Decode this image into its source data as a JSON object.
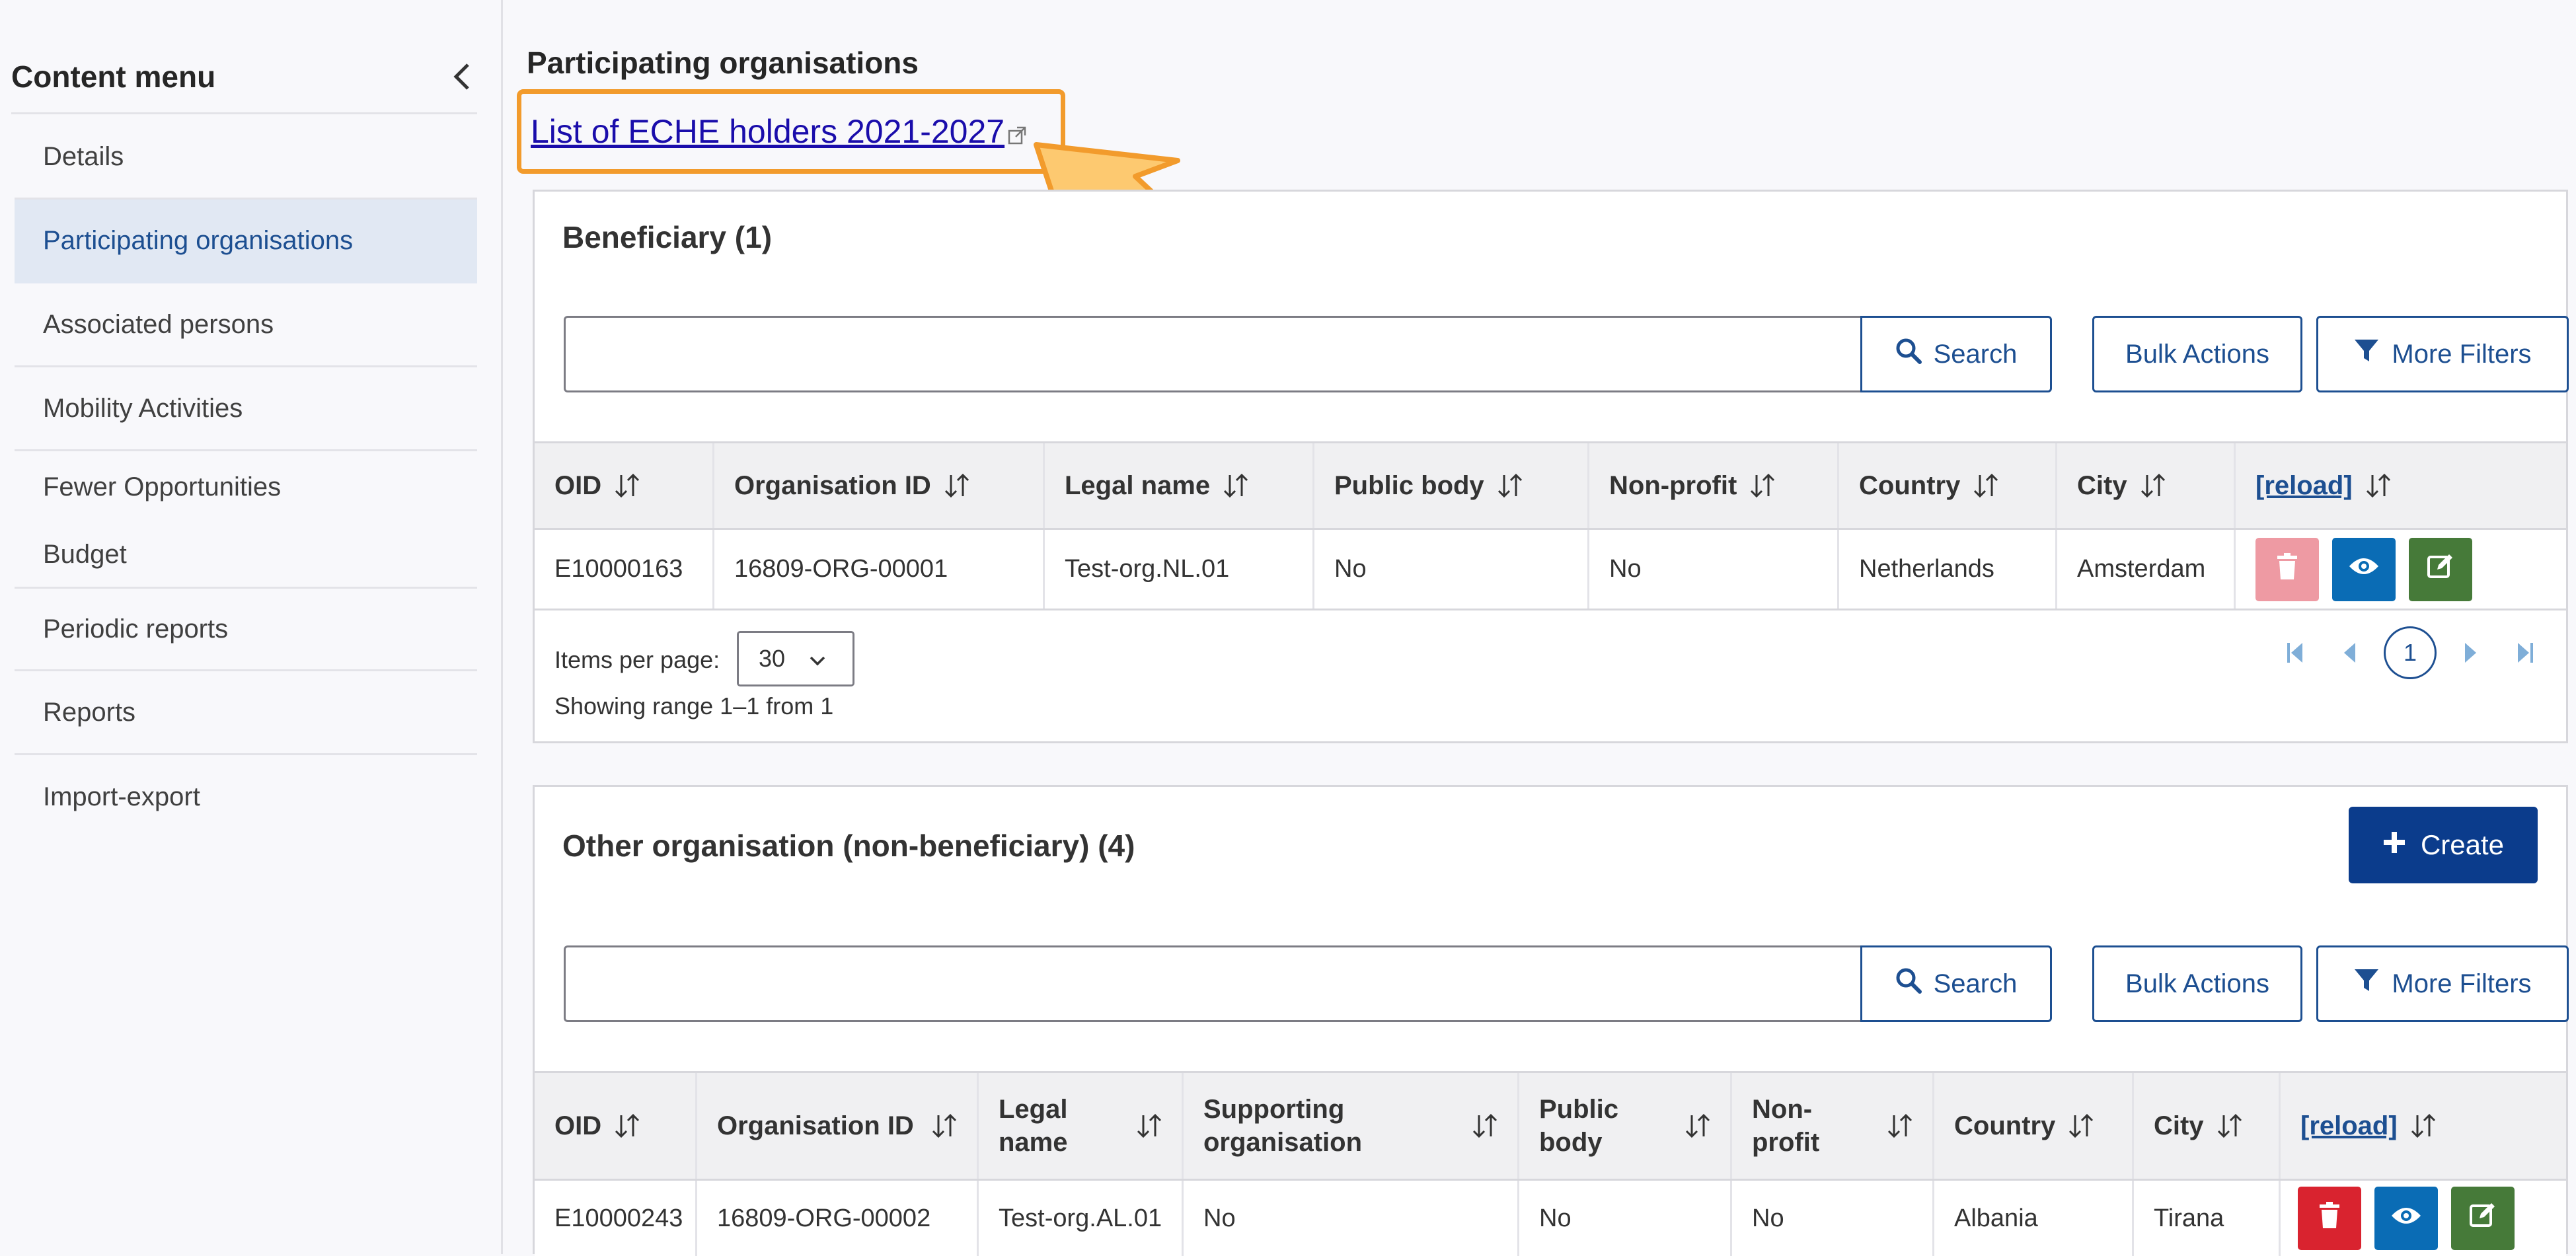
{
  "sidebar": {
    "title": "Content menu",
    "items": [
      {
        "label": "Details"
      },
      {
        "label": "Participating organisations"
      },
      {
        "label": "Associated persons"
      },
      {
        "label": "Mobility Activities"
      },
      {
        "label": "Fewer Opportunities"
      },
      {
        "label": "Budget"
      },
      {
        "label": "Periodic reports"
      },
      {
        "label": "Reports"
      },
      {
        "label": "Import-export"
      }
    ]
  },
  "main": {
    "title": "Participating organisations",
    "eche_link": "List of ECHE holders 2021-2027"
  },
  "toolbar": {
    "search_label": "Search",
    "bulk_label": "Bulk Actions",
    "filters_label": "More Filters",
    "create_label": "Create"
  },
  "beneficiary": {
    "title": "Beneficiary (1)",
    "columns": [
      "OID",
      "Organisation ID",
      "Legal name",
      "Public body",
      "Non-profit",
      "Country",
      "City",
      "[reload]"
    ],
    "rows": [
      {
        "oid": "E10000163",
        "org_id": "16809-ORG-00001",
        "legal_name": "Test-org.NL.01",
        "public_body": "No",
        "non_profit": "No",
        "country": "Netherlands",
        "city": "Amsterdam"
      }
    ],
    "pagination": {
      "items_per_page_label": "Items per page:",
      "items_per_page": "30",
      "range": "Showing range 1–1 from 1",
      "current_page": "1"
    }
  },
  "other": {
    "title": "Other organisation (non-beneficiary) (4)",
    "columns": [
      "OID",
      "Organisation ID",
      "Legal name",
      "Supporting organisation",
      "Public body",
      "Non-profit",
      "Country",
      "City",
      "[reload]"
    ],
    "rows": [
      {
        "oid": "E10000243",
        "org_id": "16809-ORG-00002",
        "legal_name": "Test-org.AL.01",
        "supporting": "No",
        "public_body": "No",
        "non_profit": "No",
        "country": "Albania",
        "city": "Tirana"
      }
    ]
  },
  "colors": {
    "primary": "#1d4f91",
    "create": "#0b3c8c",
    "highlight": "#f29b2c",
    "delete": "#d9232f",
    "view": "#0a6cb5",
    "edit": "#467a39"
  }
}
